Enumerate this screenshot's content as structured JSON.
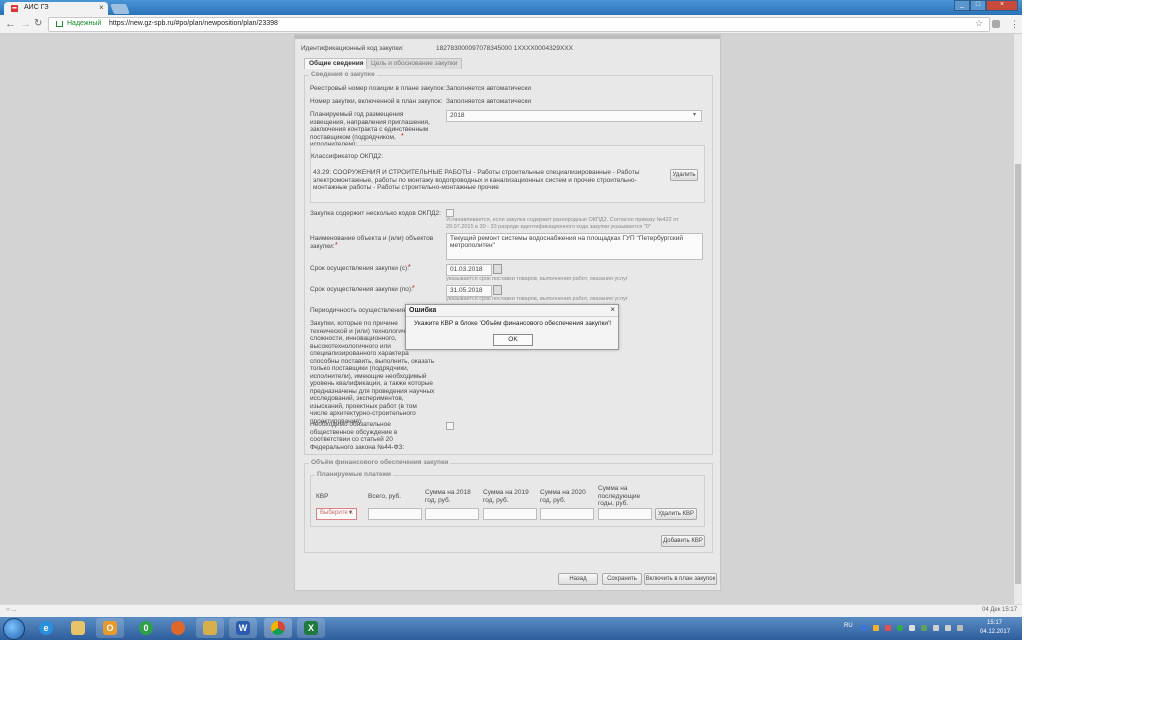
{
  "browser": {
    "tab_title": "АИС ГЗ",
    "tab_close": "×",
    "secure_label": "Надежный",
    "url": "https://new.gz-spb.ru/#po/plan/newposition/plan/23398",
    "star": "☆",
    "win_minimize": "_",
    "win_maximize": "□",
    "win_close": "×"
  },
  "form": {
    "ident_label": "Идентификационный код закупки:",
    "ident_value": "182783000097078345000 1XXXX0004329XXX",
    "tabs": [
      {
        "label": "Общие сведения"
      },
      {
        "label": "Цель и обоснование закупки"
      }
    ],
    "section_general": "Сведения о закупке",
    "reg_num_label": "Реестровый номер позиции в плане закупок:",
    "reg_num_value": "Заполняется автоматически",
    "purchase_num_label": "Номер закупки, включенной в план закупок:",
    "purchase_num_value": "Заполняется автоматически",
    "plan_year_label": "Планируемый год размещения извещения, направления приглашения, заключения контракта с единственным поставщиком (подрядчиком, исполнителем):",
    "plan_year_value": "2018",
    "okpd_label": "Классификатор ОКПД2:",
    "okpd_value": "43.29: СООРУЖЕНИЯ И СТРОИТЕЛЬНЫЕ РАБОТЫ - Работы строительные специализированные - Работы электромонтажные, работы по монтажу водопроводных и канализационных систем и прочие строительно-монтажные работы - Работы строительно-монтажные прочие",
    "okpd_delete": "Удалить",
    "multi_okpd_label": "Закупка содержит несколько кодов ОКПД2:",
    "multi_okpd_hint": "Устанавливается, если закупка содержит разнородные ОКПД2. Согласно приказу №422 от 29.07.2015 в 30 - 33 разряде идентификационного кода закупки указывается \"0\"",
    "object_name_label": "Наименование объекта и (или) объектов закупки:",
    "object_name_value": "Текущий ремонт системы водоснабжения на площадках ГУП \"Петербургский метрополитен\"",
    "date_from_label": "Срок осуществления закупки (с):",
    "date_from_value": "01.03.2018",
    "date_from_hint": "указывается срок поставки товаров, выполнения работ, оказания услуг",
    "date_to_label": "Срок осуществления закупки (по):",
    "date_to_value": "31.05.2018",
    "date_to_hint": "указывается срок поставки товаров, выполнения работ, оказания услуг",
    "periodicity_label": "Периодичность осуществления",
    "special_label": "Закупки, которые по причине технической и (или) технологической сложности, инновационного, высокотехнологичного или специализированного характера способны поставить, выполнить, оказать только поставщики (подрядчики, исполнители), имеющие необходимый уровень квалификации, а также которые предназначены для проведения научных исследований, экспериментов, изысканий, проектных работ (в том числе архитектурно-строительного проектирования):",
    "public_label": "Необходимо обязательное общественное обсуждение в соответствии со статьей 20 Федерального закона №44-ФЗ:",
    "section_finance": "Объём финансового обеспечения закупки",
    "section_payments": "Планируемые платежи",
    "payment_columns": [
      "КВР",
      "Всего, руб.",
      "Сумма на 2018 год, руб.",
      "Сумма на 2019 год, руб.",
      "Сумма на 2020 год, руб.",
      "Сумма на последующие годы, руб."
    ],
    "kvr_placeholder": "Выберите К",
    "delete_kvr": "Удалить КВР",
    "add_kvr": "Добавить КВР",
    "back": "Назад",
    "save": "Сохранить",
    "include": "Включить в план закупок"
  },
  "dialog": {
    "title": "Ошибка",
    "close": "×",
    "message": "Укажите КВР в блоке 'Объём финансового обеспечения закупки'!",
    "ok": "OK"
  },
  "status": {
    "left": "○ ...",
    "right": "04 Дек 15:17"
  },
  "taskbar": {
    "lang": "RU",
    "time": "15:17",
    "date": "04.12.2017"
  }
}
